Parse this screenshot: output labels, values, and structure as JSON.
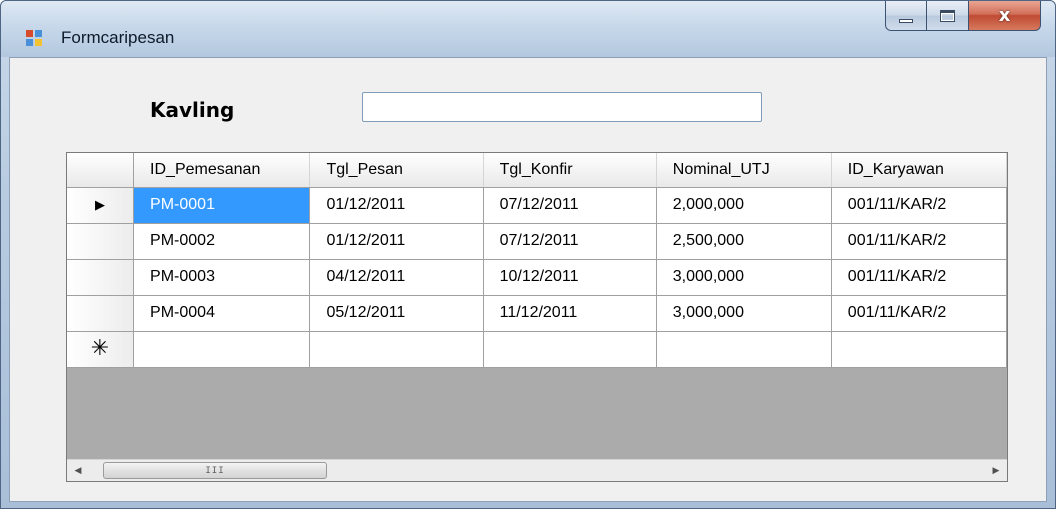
{
  "window": {
    "title": "Formcaripesan",
    "close_glyph": "x",
    "icon": "form-app-icon"
  },
  "form": {
    "kavling_label": "Kavling",
    "kavling_value": ""
  },
  "grid": {
    "columns": [
      "ID_Pemesanan",
      "Tgl_Pesan",
      "Tgl_Konfir",
      "Nominal_UTJ",
      "ID_Karyawan"
    ],
    "rows": [
      [
        "PM-0001",
        "01/12/2011",
        "07/12/2011",
        "2,000,000",
        "001/11/KAR/2"
      ],
      [
        "PM-0002",
        "01/12/2011",
        "07/12/2011",
        "2,500,000",
        "001/11/KAR/2"
      ],
      [
        "PM-0003",
        "04/12/2011",
        "10/12/2011",
        "3,000,000",
        "001/11/KAR/2"
      ],
      [
        "PM-0004",
        "05/12/2011",
        "11/12/2011",
        "3,000,000",
        "001/11/KAR/2"
      ]
    ],
    "current_row_marker": "▶",
    "new_row_marker": "✳",
    "scroll_left": "◀",
    "scroll_right": "▶",
    "scroll_grip": "III"
  }
}
